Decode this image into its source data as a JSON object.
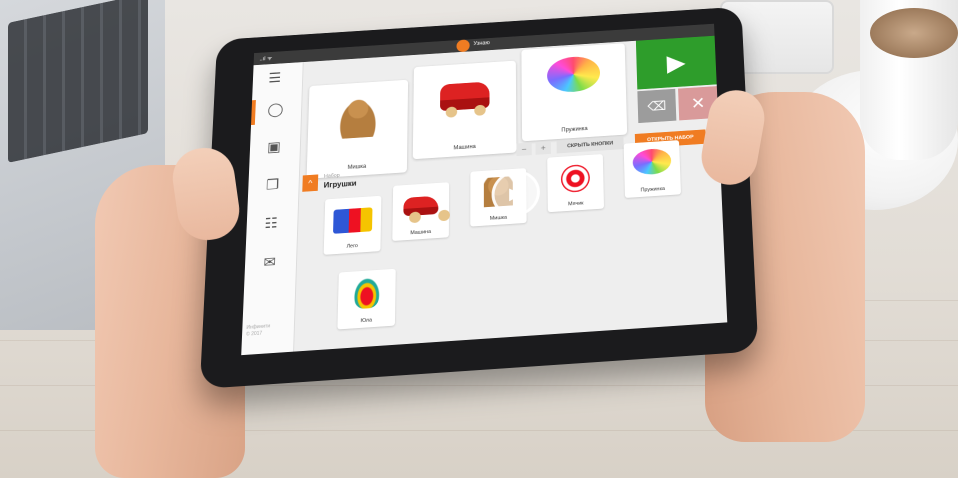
{
  "status_bar": {
    "signal_text": "..ıl ᯤ",
    "app_name": "Узнаю"
  },
  "sidebar": {
    "icons": [
      "hamburger-menu-icon",
      "speech-bubble-icon",
      "window-icon",
      "photos-icon",
      "list-icon",
      "mail-icon"
    ],
    "copyright": "Инфинити\n© 2017"
  },
  "sentence_strip": {
    "cards": [
      {
        "label": "Мишка",
        "picture": "teddy-bear"
      },
      {
        "label": "Машина",
        "picture": "toy-car"
      },
      {
        "label": "Пружинка",
        "picture": "rainbow-spring"
      }
    ],
    "play_icon": "play-icon",
    "backspace_icon": "backspace-icon",
    "clear_icon": "close-icon"
  },
  "controls": {
    "minus": "−",
    "plus": "+",
    "hide_buttons": "СКРЫТЬ КНОПКИ",
    "open_set": "ОТКРЫТЬ НАБОР"
  },
  "set": {
    "caption": "Набор",
    "name": "Игрушки",
    "cards": [
      {
        "label": "Лего",
        "picture": "lego-blocks"
      },
      {
        "label": "Машина",
        "picture": "toy-car"
      },
      {
        "label": "Мишка",
        "picture": "teddy-bear"
      },
      {
        "label": "Мячик",
        "picture": "soccer-ball"
      },
      {
        "label": "Пружинка",
        "picture": "rainbow-spring"
      },
      {
        "label": "Юла",
        "picture": "spinning-top"
      }
    ]
  },
  "video_overlay": {
    "icon": "play-circle-icon"
  },
  "colors": {
    "accent": "#f07c22",
    "play_green": "#2e9d2b",
    "clear_red": "#d99a9a",
    "backspace_gray": "#9c9c9c"
  }
}
